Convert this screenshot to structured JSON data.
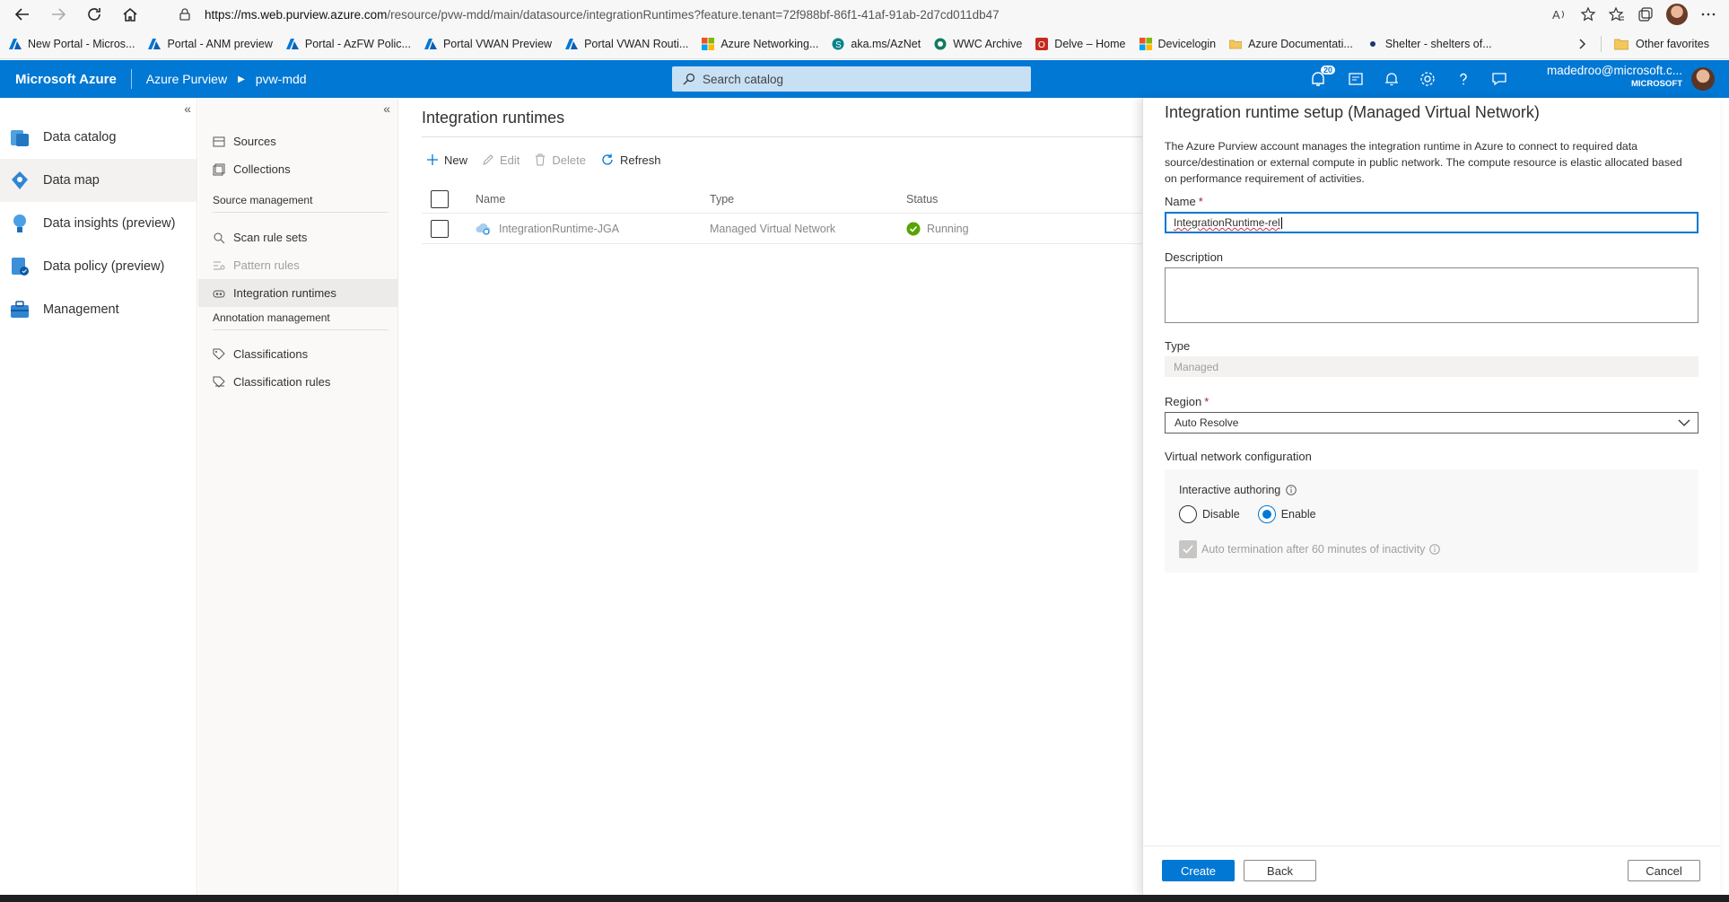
{
  "browser": {
    "url_host": "https://ms.web.purview.azure.com",
    "url_path": "/resource/pvw-mdd/main/datasource/integrationRuntimes?feature.tenant=72f988bf-86f1-41af-91ab-2d7cd011db47",
    "favorites": [
      {
        "label": "New Portal - Micros...",
        "icon": "azure-icon"
      },
      {
        "label": "Portal - ANM preview",
        "icon": "azure-icon"
      },
      {
        "label": "Portal - AzFW Polic...",
        "icon": "azure-icon"
      },
      {
        "label": "Portal VWAN Preview",
        "icon": "azure-icon"
      },
      {
        "label": "Portal VWAN Routi...",
        "icon": "azure-icon"
      },
      {
        "label": "Azure Networking...",
        "icon": "microsoft-icon"
      },
      {
        "label": "aka.ms/AzNet",
        "icon": "sharepoint-icon"
      },
      {
        "label": "WWC Archive",
        "icon": "globe-icon"
      },
      {
        "label": "Delve – Home",
        "icon": "office-icon"
      },
      {
        "label": "Devicelogin",
        "icon": "microsoft-icon"
      },
      {
        "label": "Azure Documentati...",
        "icon": "folder-icon"
      },
      {
        "label": "Shelter - shelters of...",
        "icon": "dot-icon"
      }
    ],
    "other_favorites": "Other favorites"
  },
  "header": {
    "brand": "Microsoft Azure",
    "crumb1": "Azure Purview",
    "crumb2": "pvw-mdd",
    "search_placeholder": "Search catalog",
    "notification_count": "20",
    "user_email": "madedroo@microsoft.c...",
    "user_org": "MICROSOFT"
  },
  "rail": {
    "items": [
      {
        "label": "Data catalog"
      },
      {
        "label": "Data map"
      },
      {
        "label": "Data insights (preview)"
      },
      {
        "label": "Data policy (preview)"
      },
      {
        "label": "Management"
      }
    ]
  },
  "subnav": {
    "sources": "Sources",
    "collections": "Collections",
    "source_mgmt_head": "Source management",
    "scan_rule_sets": "Scan rule sets",
    "pattern_rules": "Pattern rules",
    "integration_runtimes": "Integration runtimes",
    "annotation_head": "Annotation management",
    "classifications": "Classifications",
    "classification_rules": "Classification rules"
  },
  "main": {
    "title": "Integration runtimes",
    "toolbar": {
      "new": "New",
      "edit": "Edit",
      "delete": "Delete",
      "refresh": "Refresh"
    },
    "columns": {
      "name": "Name",
      "type": "Type",
      "status": "Status"
    },
    "rows": [
      {
        "name": "IntegrationRuntime-JGA",
        "type": "Managed Virtual Network",
        "status": "Running"
      }
    ]
  },
  "panel": {
    "title": "Integration runtime setup (Managed Virtual Network)",
    "description": "The Azure Purview account manages the integration runtime in Azure to connect to required data source/destination or external compute in public network. The compute resource is elastic allocated based on performance requirement of activities.",
    "name_label": "Name",
    "name_value": "IntegrationRuntime-rel",
    "description_label": "Description",
    "description_value": "",
    "type_label": "Type",
    "type_value": "Managed",
    "region_label": "Region",
    "region_value": "Auto Resolve",
    "vnet_label": "Virtual network configuration",
    "interactive_label": "Interactive authoring",
    "disable_label": "Disable",
    "enable_label": "Enable",
    "interactive_selected": "Enable",
    "auto_term_label": "Auto termination after 60 minutes of inactivity",
    "create": "Create",
    "back": "Back",
    "cancel": "Cancel"
  },
  "colors": {
    "accent": "#0078d4",
    "running": "#57a300",
    "required": "#a4262c"
  }
}
